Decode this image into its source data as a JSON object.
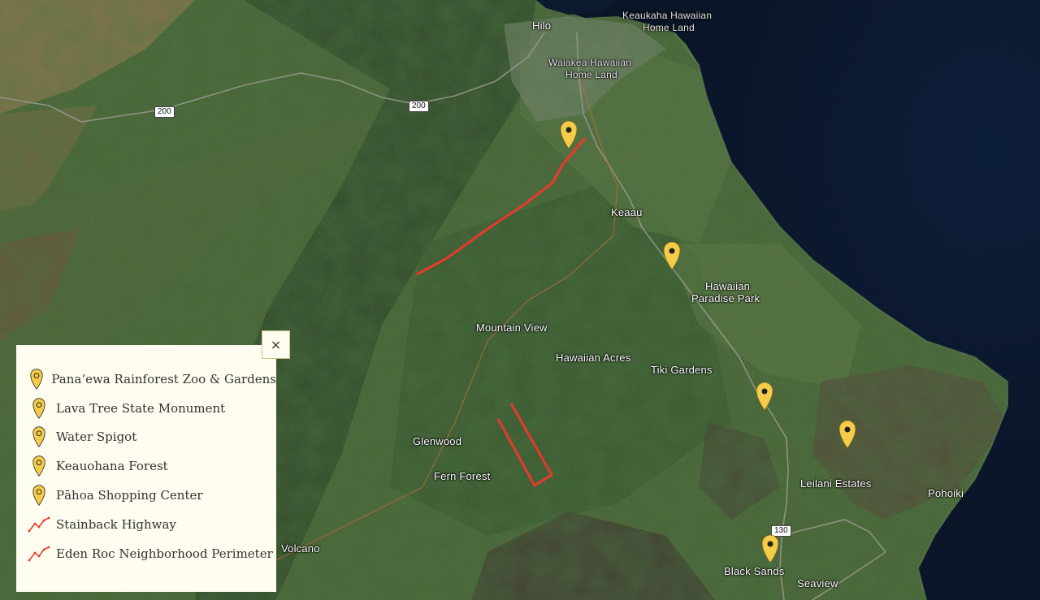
{
  "map": {
    "place_labels": [
      {
        "id": "hilo",
        "text": "Hilo"
      },
      {
        "id": "keaukaha",
        "text": "Keaukaha Hawaiian"
      },
      {
        "id": "keaukaha2",
        "text": "Home Land"
      },
      {
        "id": "waiakea",
        "text": "Waiakea Hawaiian"
      },
      {
        "id": "waiakea2",
        "text": "Home Land"
      },
      {
        "id": "keaau",
        "text": "Keaau"
      },
      {
        "id": "hpp1",
        "text": "Hawaiian"
      },
      {
        "id": "hpp2",
        "text": "Paradise Park"
      },
      {
        "id": "mountain-view",
        "text": "Mountain View"
      },
      {
        "id": "hawaiian-acres",
        "text": "Hawaiian Acres"
      },
      {
        "id": "tiki-gardens",
        "text": "Tiki Gardens"
      },
      {
        "id": "glenwood",
        "text": "Glenwood"
      },
      {
        "id": "fern-forest",
        "text": "Fern Forest"
      },
      {
        "id": "leilani",
        "text": "Leilani Estates"
      },
      {
        "id": "pohoiki",
        "text": "Pohoiki"
      },
      {
        "id": "volcano",
        "text": "Volcano"
      },
      {
        "id": "black-sands",
        "text": "Black Sands"
      },
      {
        "id": "seaview",
        "text": "Seaview"
      }
    ],
    "route_shields": [
      {
        "id": "r200a",
        "text": "200"
      },
      {
        "id": "r200b",
        "text": "200"
      },
      {
        "id": "r130",
        "text": "130"
      }
    ],
    "marker_color": "#f5cc4a",
    "line_color": "#e8392b"
  },
  "legend": {
    "items": [
      {
        "type": "marker",
        "icon": "map-pin-icon",
        "label": "Pana‘ewa Rainforest Zoo & Gardens"
      },
      {
        "type": "marker",
        "icon": "map-pin-icon",
        "label": "Lava Tree State Monument"
      },
      {
        "type": "marker",
        "icon": "map-pin-icon",
        "label": "Water Spigot"
      },
      {
        "type": "marker",
        "icon": "map-pin-icon",
        "label": "Keauohana Forest"
      },
      {
        "type": "marker",
        "icon": "map-pin-icon",
        "label": "Pāhoa Shopping Center"
      },
      {
        "type": "line",
        "icon": "polyline-icon",
        "label": "Stainback Highway"
      },
      {
        "type": "line",
        "icon": "polyline-icon",
        "label": "Eden Roc Neighborhood Perimeter"
      }
    ]
  },
  "close_button": {
    "icon": "close-icon",
    "glyph": "×"
  }
}
